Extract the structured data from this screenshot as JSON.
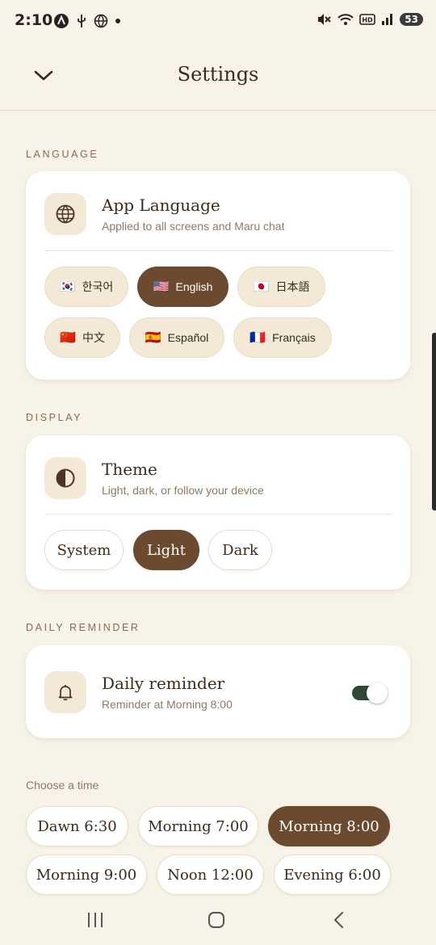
{
  "status": {
    "time": "2:10",
    "battery": "53"
  },
  "header": {
    "title": "Settings"
  },
  "language": {
    "section_label": "LANGUAGE",
    "title": "App Language",
    "subtitle": "Applied to all screens and Maru chat",
    "options": [
      {
        "flag": "🇰🇷",
        "label": "한국어",
        "selected": false
      },
      {
        "flag": "🇺🇸",
        "label": "English",
        "selected": true
      },
      {
        "flag": "🇯🇵",
        "label": "日本語",
        "selected": false
      },
      {
        "flag": "🇨🇳",
        "label": "中文",
        "selected": false
      },
      {
        "flag": "🇪🇸",
        "label": "Español",
        "selected": false
      },
      {
        "flag": "🇫🇷",
        "label": "Français",
        "selected": false
      }
    ]
  },
  "display": {
    "section_label": "DISPLAY",
    "title": "Theme",
    "subtitle": "Light, dark, or follow your device",
    "options": [
      {
        "label": "System",
        "selected": false
      },
      {
        "label": "Light",
        "selected": true
      },
      {
        "label": "Dark",
        "selected": false
      }
    ]
  },
  "reminder": {
    "section_label": "DAILY REMINDER",
    "title": "Daily reminder",
    "subtitle": "Reminder at Morning 8:00",
    "enabled": true,
    "choose_label": "Choose a time",
    "times": [
      {
        "label": "Dawn 6:30",
        "selected": false
      },
      {
        "label": "Morning 7:00",
        "selected": false
      },
      {
        "label": "Morning 8:00",
        "selected": true
      },
      {
        "label": "Morning 9:00",
        "selected": false
      },
      {
        "label": "Noon 12:00",
        "selected": false
      },
      {
        "label": "Evening 6:00",
        "selected": false
      }
    ]
  },
  "colors": {
    "accent": "#6B4A30",
    "background": "#F8F3E8",
    "chip_bg": "#F3E9D6",
    "toggle_on": "#2F4A35"
  }
}
